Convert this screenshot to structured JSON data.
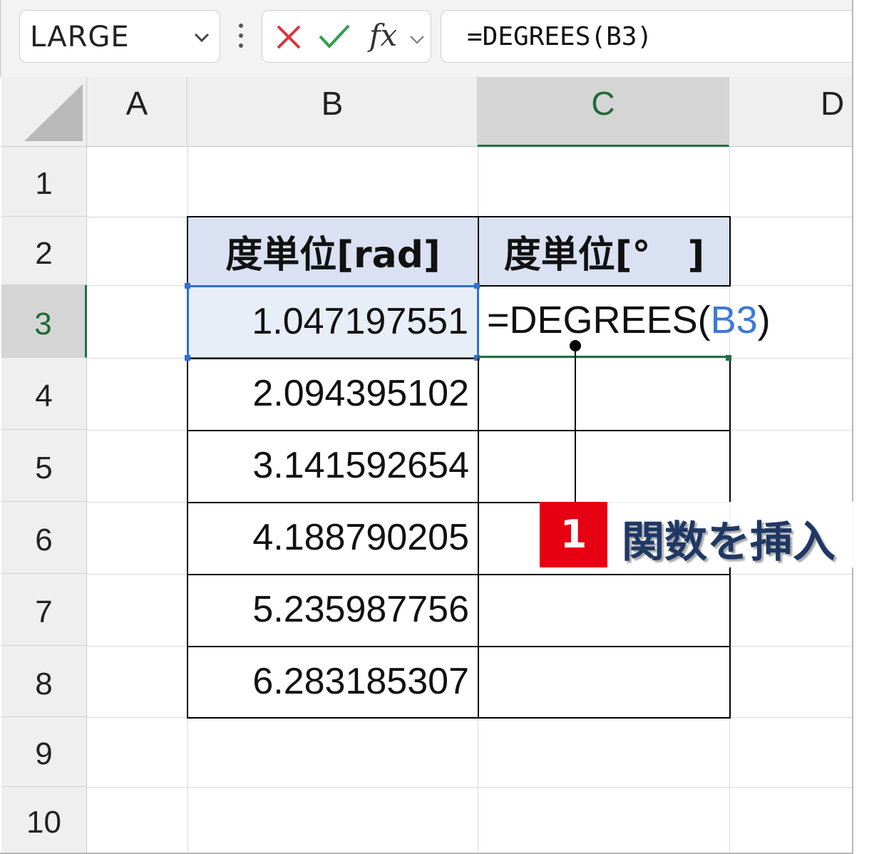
{
  "formula_bar": {
    "name_box": "LARGE",
    "fx_label": "fx",
    "formula": "=DEGREES(B3)"
  },
  "columns": [
    "A",
    "B",
    "C",
    "D"
  ],
  "rows": [
    "1",
    "2",
    "3",
    "4",
    "5",
    "6",
    "7",
    "8",
    "9",
    "10"
  ],
  "table": {
    "header_b": "度単位[rad]",
    "header_c": "度単位[°　]",
    "values_b": [
      "1.047197551",
      "2.094395102",
      "3.141592654",
      "4.188790205",
      "5.235987756",
      "6.283185307"
    ]
  },
  "editing_cell": {
    "prefix": "=DEGREES(",
    "ref": "B3",
    "suffix": ")"
  },
  "callout": {
    "number": "1",
    "text": "関数を挿入"
  },
  "colors": {
    "selection_green": "#1e7145",
    "reference_blue": "#3c78d8",
    "header_fill": "#d9e1f2",
    "badge_red": "#e60012",
    "label_navy": "#1f3864"
  }
}
